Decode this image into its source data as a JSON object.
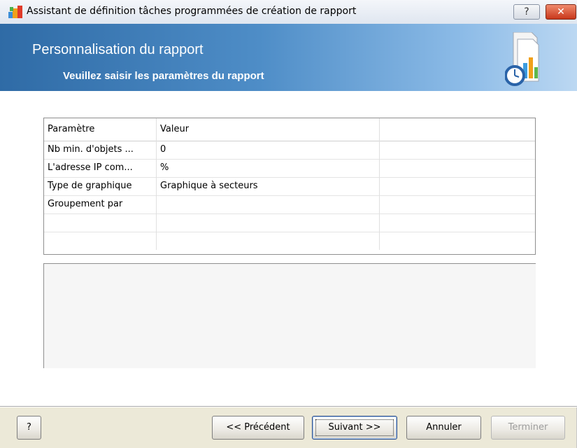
{
  "window": {
    "title": "Assistant de définition tâches programmées de création de rapport",
    "help_glyph": "?",
    "close_glyph": "✕"
  },
  "banner": {
    "title": "Personnalisation du rapport",
    "subtitle": "Veuillez saisir les paramètres du rapport"
  },
  "grid": {
    "headers": [
      "Paramètre",
      "Valeur",
      ""
    ],
    "rows": [
      {
        "param": "Nb min. d'objets ...",
        "value": "0"
      },
      {
        "param": "L'adresse IP com...",
        "value": "%"
      },
      {
        "param": "Type de graphique",
        "value": "Graphique à secteurs"
      },
      {
        "param": "Groupement par",
        "value": ""
      },
      {
        "param": "",
        "value": ""
      },
      {
        "param": "",
        "value": ""
      }
    ]
  },
  "buttons": {
    "help": "?",
    "previous": "<< Précédent",
    "next": "Suivant >>",
    "cancel": "Annuler",
    "finish": "Terminer"
  },
  "colors": {
    "banner_dark": "#2f6ba6",
    "banner_light": "#bcd8f2",
    "close_red": "#c8371b"
  }
}
